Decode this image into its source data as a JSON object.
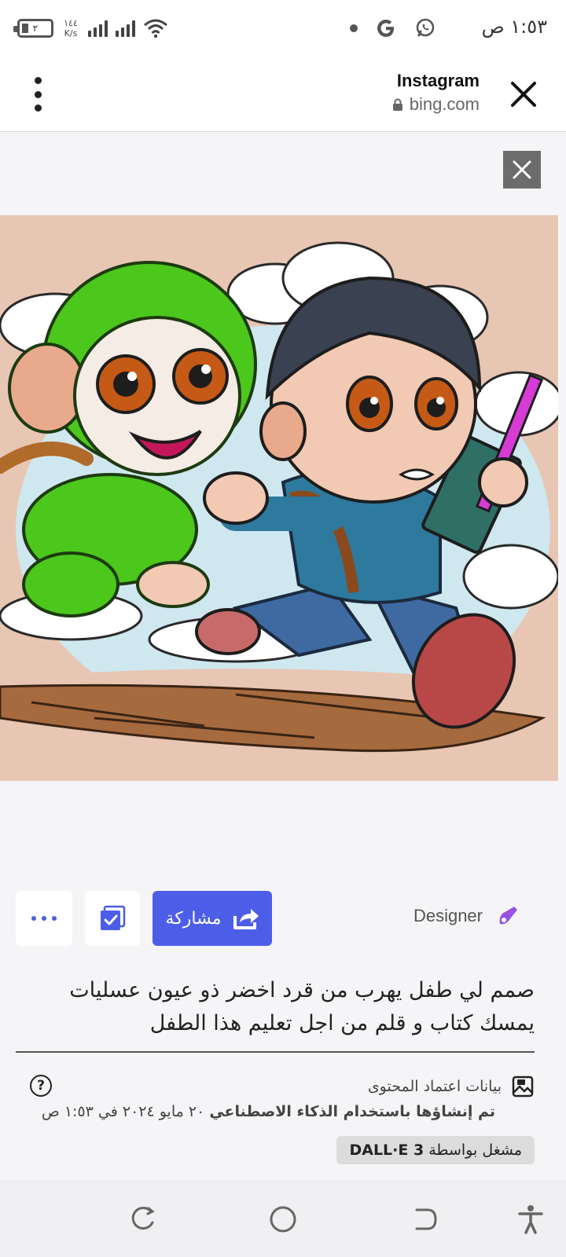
{
  "status_bar": {
    "time": "١:٥٣ ص",
    "battery_level": "٢",
    "net_speed_value": "١٤٤",
    "net_speed_unit": "K/s",
    "icons": [
      "whatsapp-icon",
      "google-icon",
      "notification-dot-icon",
      "wifi-icon",
      "signal-icon",
      "battery-icon"
    ]
  },
  "header": {
    "title": "Instagram",
    "url": "bing.com",
    "icons": [
      "close-icon",
      "lock-icon",
      "more-vertical-icon"
    ]
  },
  "image": {
    "icons": [
      "dismiss-icon"
    ]
  },
  "actions": {
    "share_label": "مشاركة",
    "designer_label": "Designer",
    "icons": [
      "share-icon",
      "select-checkbox-icon",
      "more-horizontal-icon",
      "designer-logo-icon"
    ]
  },
  "prompt_text": "صمم لي طفل يهرب من قرد اخضر ذو عيون عسليات يمسك كتاب و قلم من اجل تعليم هذا الطفل",
  "credentials": {
    "label": "بيانات اعتماد المحتوى",
    "created_bold": "تم إنشاؤها باستخدام الذكاء الاصطناعي",
    "created_date": "٢٠ مايو ٢٠٢٤ في ١:٥٣ ص",
    "powered_prefix": "مشغل بواسطة",
    "powered_model": "DALL·E 3",
    "info_symbol": "?"
  },
  "nav_bar": {
    "icons": [
      "accessibility-icon",
      "back-icon",
      "home-icon",
      "recents-icon"
    ]
  },
  "colors": {
    "accent": "#4c5ee8",
    "artwork_background": "#e8c6b4",
    "page_background": "#f5f5f7"
  }
}
